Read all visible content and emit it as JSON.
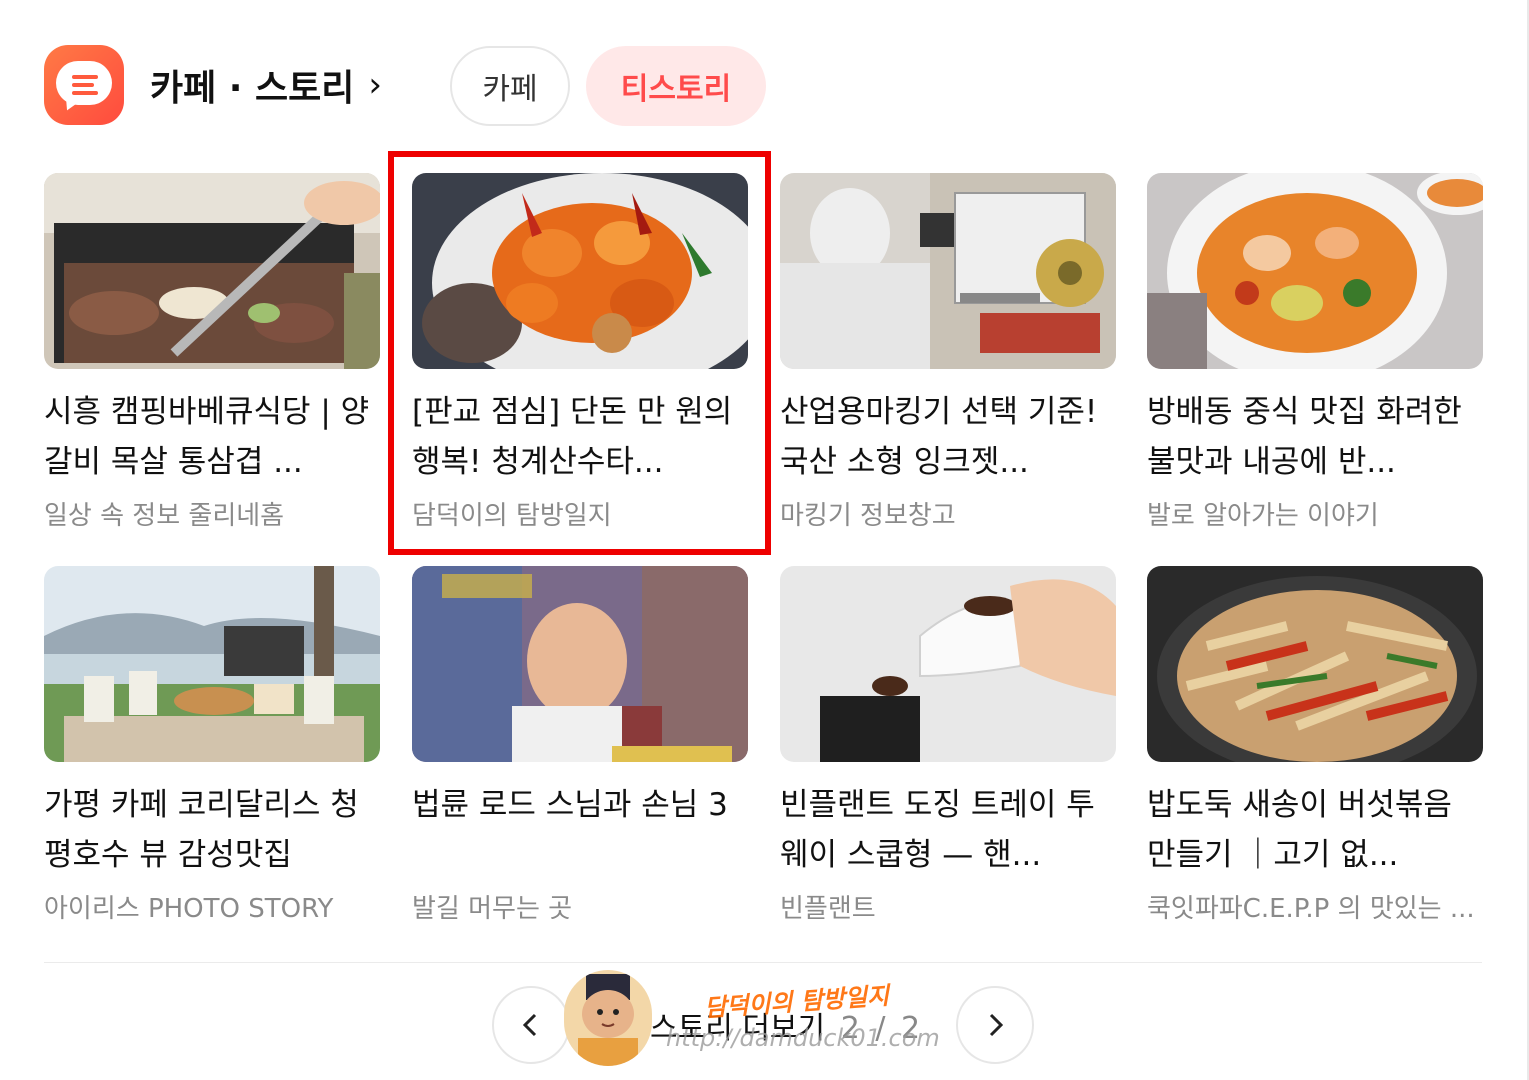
{
  "header": {
    "title": "카페 · 스토리",
    "title_chevron": "›",
    "tabs": [
      {
        "label": "카페",
        "active": false
      },
      {
        "label": "티스토리",
        "active": true
      }
    ]
  },
  "cards": [
    {
      "title": "시흥 캠핑바베큐식당 | 양갈비 목살 통삼겹 ...",
      "source": "일상 속 정보 줄리네홈"
    },
    {
      "title": "[판교 점심] 단돈 만 원의 행복! 청계산수타...",
      "source": "담덕이의 탐방일지"
    },
    {
      "title": "산업용마킹기 선택 기준! 국산 소형 잉크젯...",
      "source": "마킹기 정보창고"
    },
    {
      "title": "방배동 중식 맛집 화려한 불맛과 내공에 반...",
      "source": "발로 알아가는 이야기"
    },
    {
      "title": "가평 카페 코리달리스 청평호수 뷰 감성맛집",
      "source": "아이리스 PHOTO STORY"
    },
    {
      "title": "법륜 로드 스님과 손님 3",
      "source": "발길 머무는 곳"
    },
    {
      "title": "빈플랜트 도징 트레이 투웨이 스쿱형 — 핸...",
      "source": "빈플랜트"
    },
    {
      "title": "밥도둑 새송이 버섯볶음 만들기 ｜고기 없...",
      "source": "쿡잇파파C.E.P.P 의 맛있는 ..."
    }
  ],
  "pagination": {
    "label": "스토리 더보기",
    "current": "2",
    "separator": "/",
    "total": "2",
    "prev_icon": "chevron-left-icon",
    "next_icon": "chevron-right-icon"
  },
  "watermark": {
    "name": "담덕이의 탐방일지",
    "url": "http://damduck01.com"
  },
  "colors": {
    "accent": "#ff4b4b",
    "accent_bg": "#ffe8e8",
    "highlight_box": "#ee0000",
    "source_text": "#8a8a8a"
  }
}
